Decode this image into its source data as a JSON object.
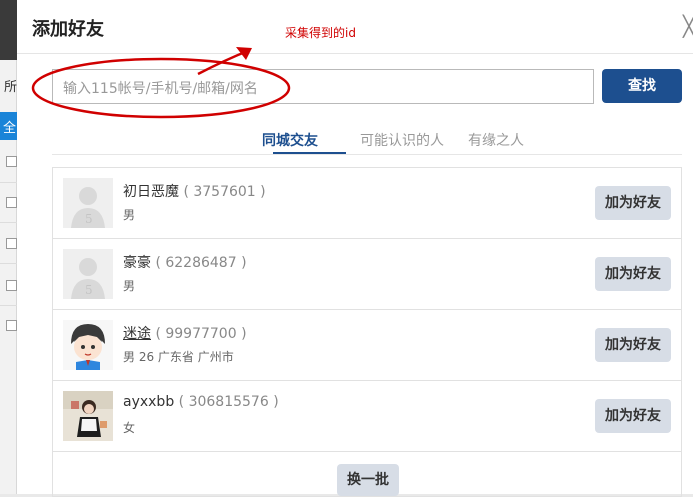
{
  "background": {
    "letters": [
      "所",
      "全"
    ]
  },
  "dialog": {
    "title": "添加好友",
    "close_glyph": "╳"
  },
  "search": {
    "placeholder": "输入115帐号/手机号/邮箱/网名",
    "button_label": "查找"
  },
  "tabs": [
    {
      "label": "同城交友",
      "active": true
    },
    {
      "label": "可能认识的人",
      "active": false
    },
    {
      "label": "有缘之人",
      "active": false
    }
  ],
  "friends": [
    {
      "name": "初日恶魔",
      "id_text": "( 3757601 )",
      "info": "男",
      "avatar": "default-avatar",
      "button": "加为好友"
    },
    {
      "name": "豪豪",
      "id_text": "( 62286487 )",
      "info": "男",
      "avatar": "default-avatar",
      "button": "加为好友"
    },
    {
      "name": "迷途",
      "id_text": "( 99977700 )",
      "info": "男  26  广东省 广州市",
      "avatar": "cartoon-avatar",
      "button": "加为好友"
    },
    {
      "name": "ayxxbb",
      "id_text": "( 306815576 )",
      "info": "女",
      "avatar": "photo-avatar",
      "button": "加为好友"
    }
  ],
  "refresh_label": "换一批",
  "annotation": {
    "text": "采集得到的id",
    "color": "#d00000"
  },
  "colors": {
    "primary": "#1d4f8f",
    "secondary_button": "#d7dde6"
  }
}
